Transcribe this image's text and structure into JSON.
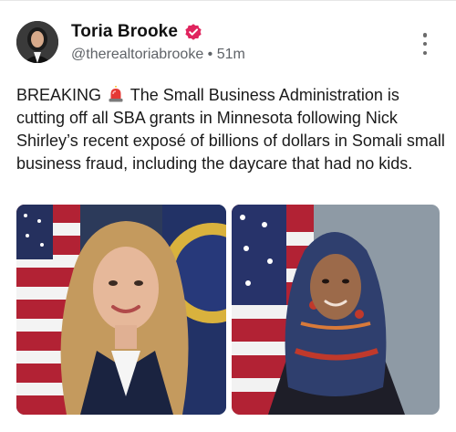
{
  "author": {
    "display_name": "Toria Brooke",
    "handle": "@therealtoriabrooke",
    "time_ago": "51m",
    "separator": "•",
    "verified_icon": "verified-badge-icon",
    "verified_color": "#e0245e"
  },
  "post": {
    "lead": "BREAKING",
    "emoji": "siren-icon",
    "body": "The Small Business Administration is cutting off all SBA grants in Minnesota following Nick Shirley’s recent exposé of billions of dollars in Somali small business fraud, including the daycare that had no kids."
  },
  "media": [
    {
      "image": "woman-with-blonde-hair-portrait-with-flag"
    },
    {
      "image": "woman-in-headscarf-portrait-with-flag"
    }
  ],
  "menu_icon": "more-options-icon"
}
